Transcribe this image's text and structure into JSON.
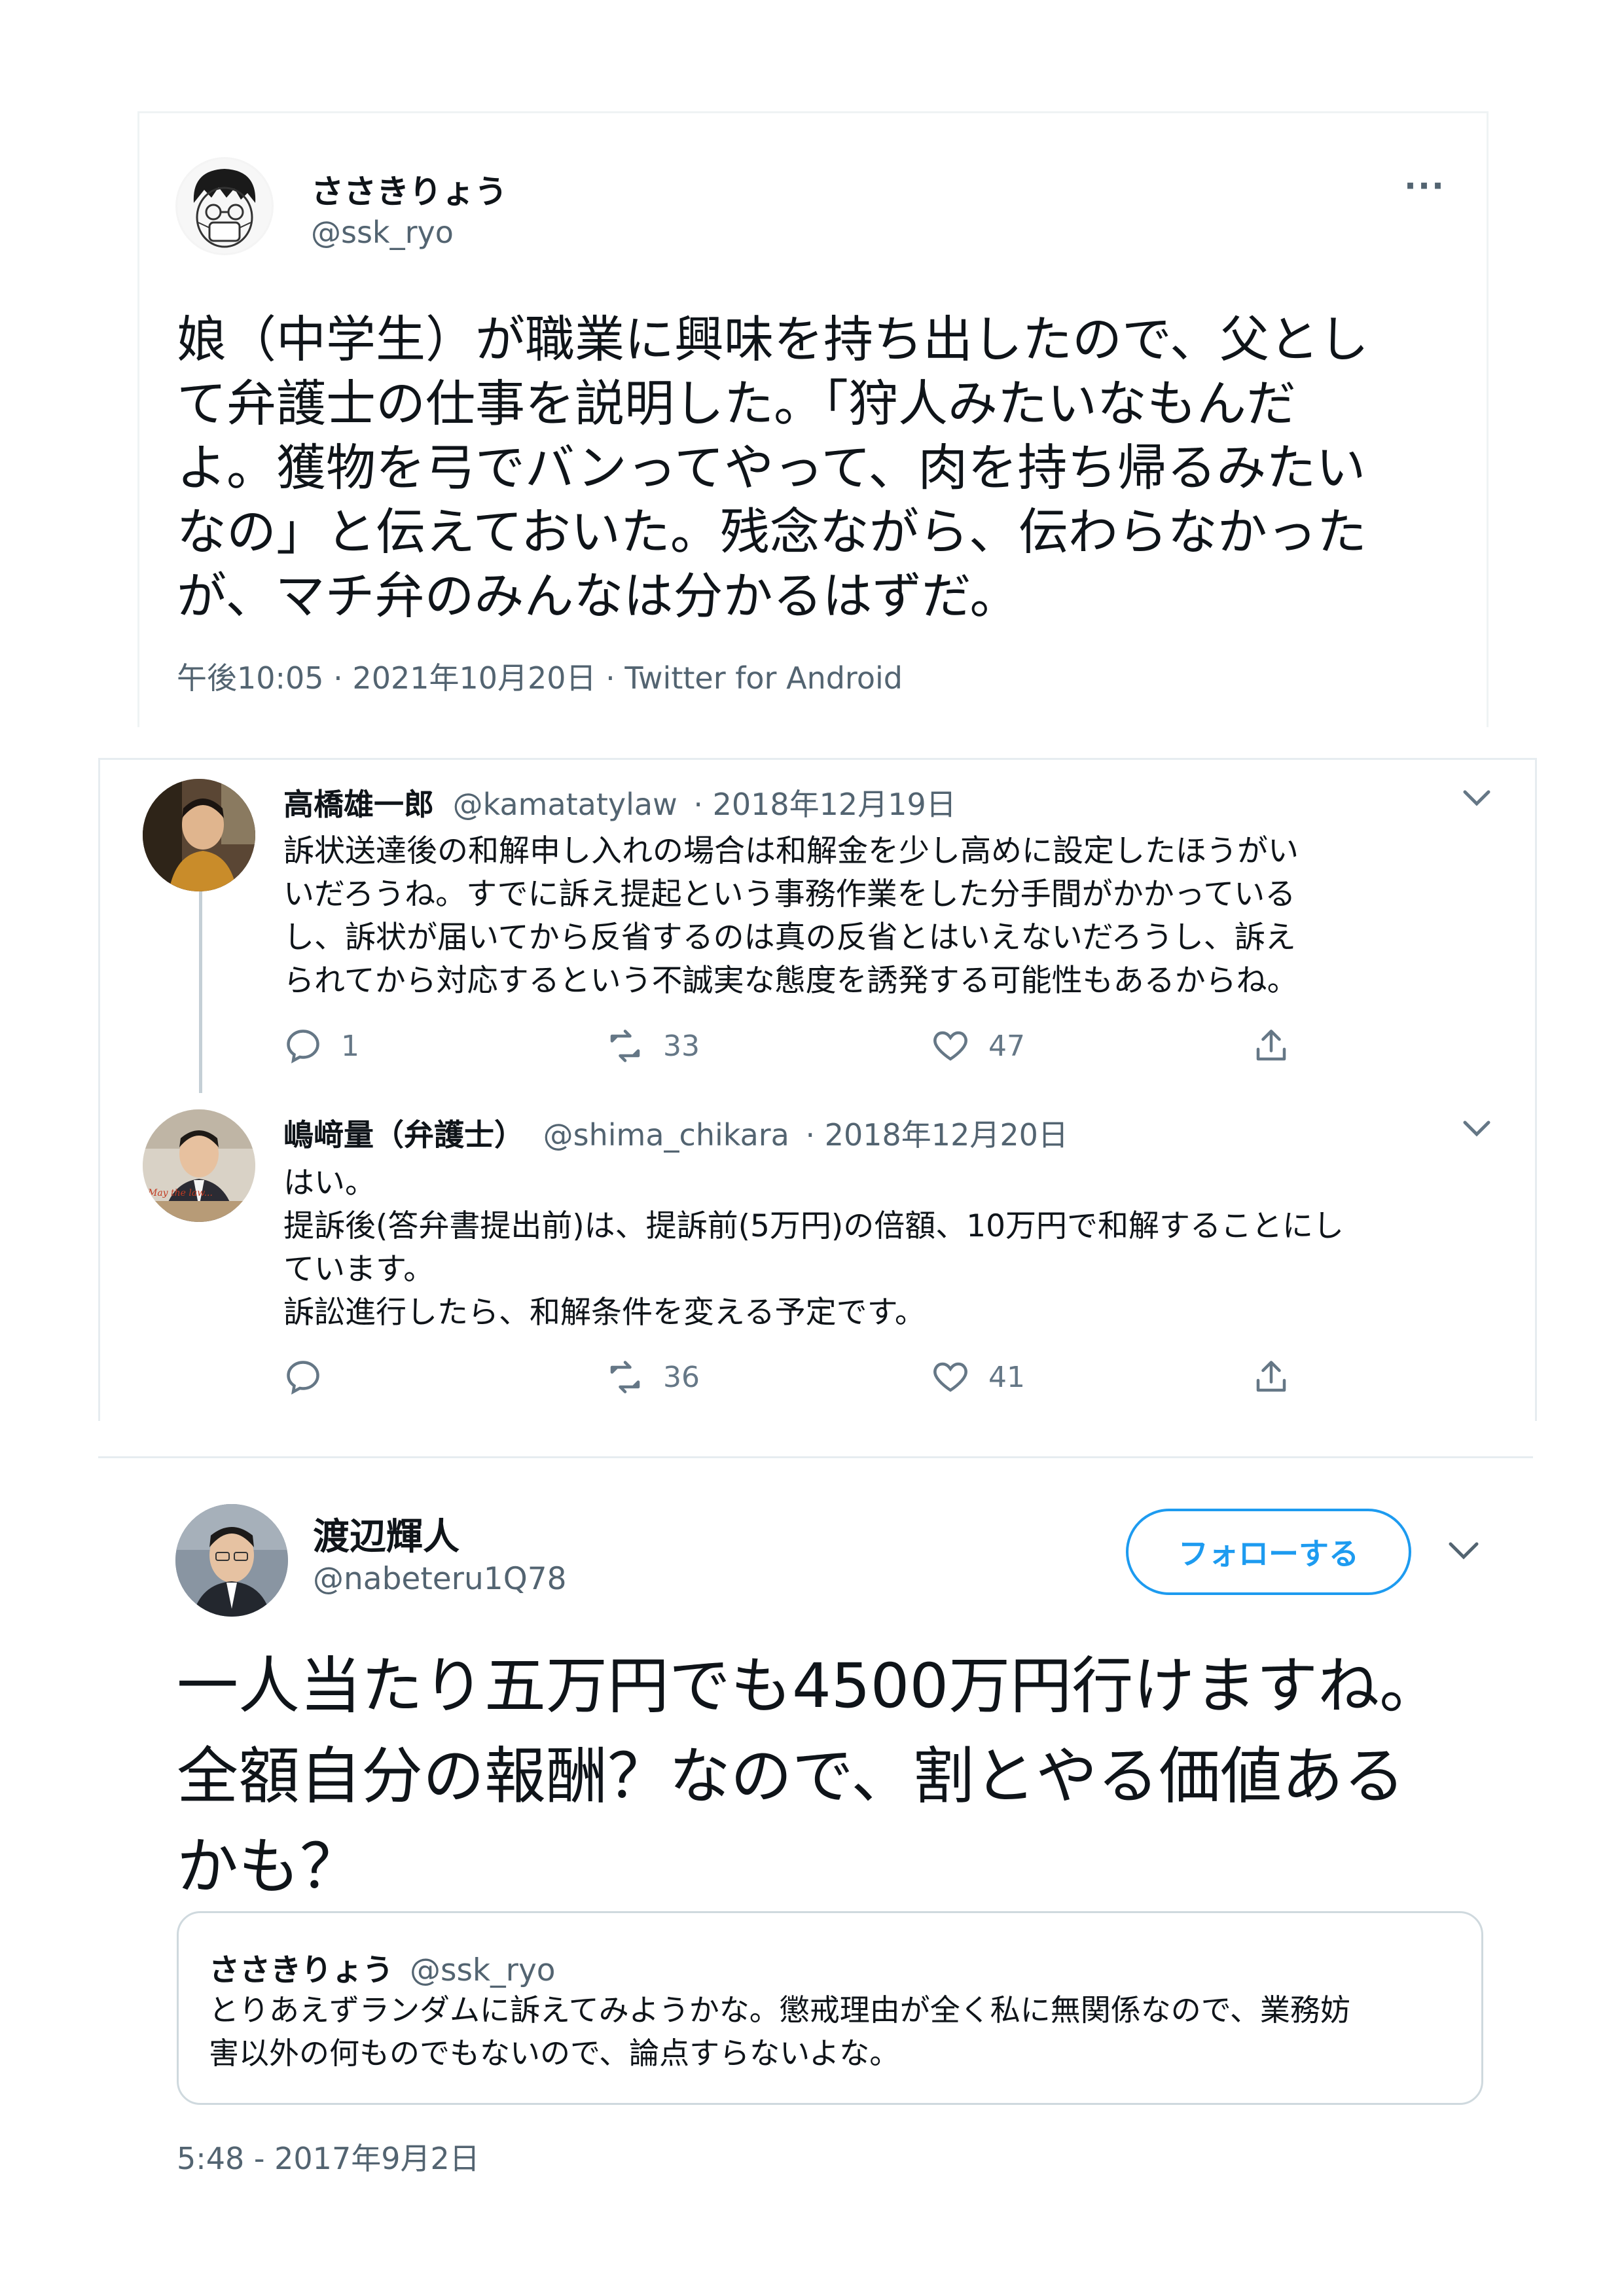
{
  "tweet1": {
    "display_name": "ささきりょう",
    "handle": "@ssk_ryo",
    "more_glyph": "···",
    "text": "娘（中学生）が職業に興味を持ち出したので、父とし\nて弁護士の仕事を説明した。「狩人みたいなもんだ\nよ。獲物を弓でバンってやって、肉を持ち帰るみたい\nなの」と伝えておいた。残念ながら、伝わらなかった\nが、マチ弁のみんなは分かるはずだ。",
    "meta": "午後10:05 · 2021年10月20日 · Twitter for Android"
  },
  "thread": {
    "reply1": {
      "display_name": "高橋雄一郎",
      "handle": "@kamatatylaw",
      "date": "· 2018年12月19日",
      "text": "訴状送達後の和解申し入れの場合は和解金を少し高めに設定したほうがい\nいだろうね。すでに訴え提起という事務作業をした分手間がかかっている\nし、訴状が届いてから反省するのは真の反省とはいえないだろうし、訴え\nられてから対応するという不誠実な態度を誘発する可能性もあるからね。",
      "reply_count": "1",
      "retweet_count": "33",
      "like_count": "47"
    },
    "reply2": {
      "display_name": "嶋﨑量（弁護士）",
      "handle": "@shima_chikara",
      "date": "· 2018年12月20日",
      "avatar_caption": "May the law...",
      "text": "はい。\n提訴後(答弁書提出前)は、提訴前(5万円)の倍額、10万円で和解することにし\nています。\n訴訟進行したら、和解条件を変える予定です。",
      "reply_count": "",
      "retweet_count": "36",
      "like_count": "41"
    }
  },
  "tweet3": {
    "display_name": "渡辺輝人",
    "handle": "@nabeteru1Q78",
    "follow_label": "フォローする",
    "text": "一人当たり五万円でも4500万円行けますね。\n全額自分の報酬？なので、割とやる価値ある\nかも？",
    "quote": {
      "display_name": "ささきりょう",
      "handle": "@ssk_ryo",
      "text": "とりあえずランダムに訴えてみようかな。懲戒理由が全く私に無関係なので、業務妨\n害以外の何ものでもないので、論点すらないよな。"
    },
    "meta": "5:48 - 2017年9月2日"
  },
  "icons": [
    "more-icon",
    "reply-icon",
    "retweet-icon",
    "like-icon",
    "share-icon",
    "chevron-down-icon"
  ],
  "colors": {
    "accent": "#1d9bf0",
    "text": "#0f1419",
    "muted": "#536471",
    "border": "#e6ecf0"
  }
}
